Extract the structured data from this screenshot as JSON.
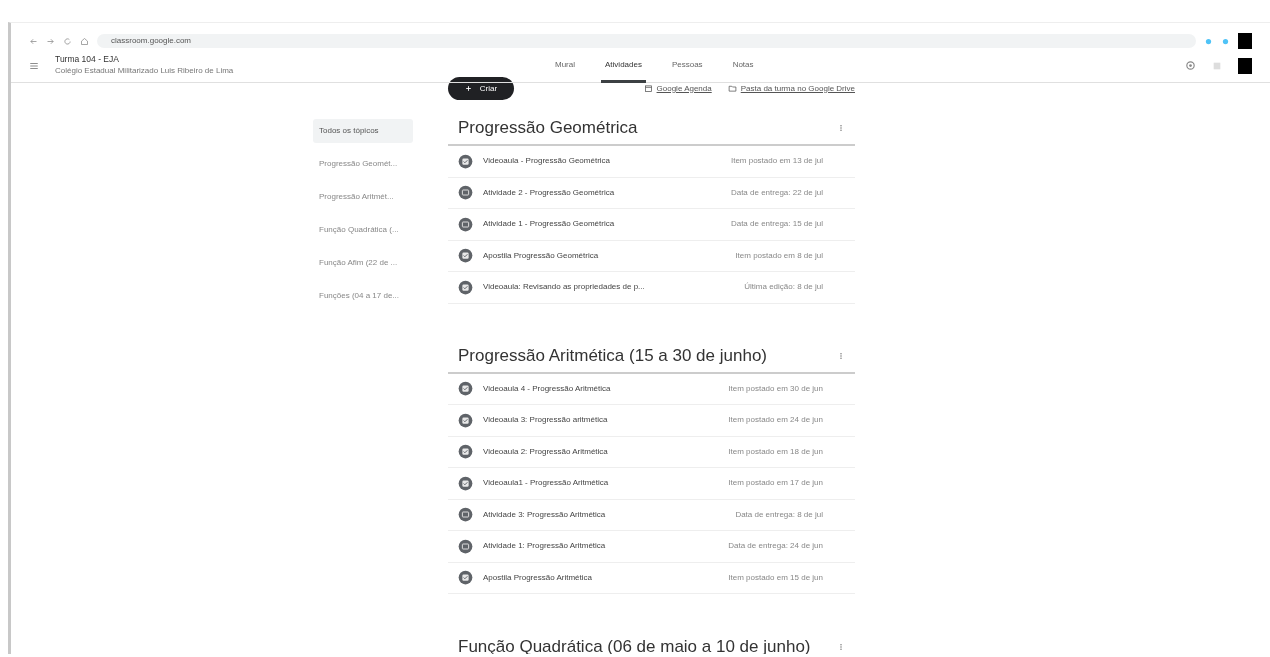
{
  "browser": {
    "url": "classroom.google.com"
  },
  "header": {
    "title": "Turma 104 - EJA",
    "subtitle": "Colégio Estadual Militarizado Luis Ribeiro de Lima"
  },
  "tabs": [
    {
      "label": "Mural",
      "selected": false
    },
    {
      "label": "Atividades",
      "selected": true
    },
    {
      "label": "Pessoas",
      "selected": false
    },
    {
      "label": "Notas",
      "selected": false
    }
  ],
  "create_button": "Criar",
  "links": [
    {
      "label": "Google Agenda",
      "kind": "calendar"
    },
    {
      "label": "Pasta da turma no Google Drive",
      "kind": "folder"
    }
  ],
  "sidebar": {
    "items": [
      {
        "label": "Todos os tópicos",
        "selected": true
      },
      {
        "label": "Progressão Geomét...",
        "selected": false
      },
      {
        "label": "Progressão Aritmét...",
        "selected": false
      },
      {
        "label": "Função Quadrática (...",
        "selected": false
      },
      {
        "label": "Função Afim (22 de ...",
        "selected": false
      },
      {
        "label": "Funções (04 a 17 de...",
        "selected": false
      }
    ]
  },
  "topics": [
    {
      "title": "Progressão Geométrica",
      "items": [
        {
          "kind": "material",
          "title": "Videoaula - Progressão Geométrica",
          "meta": "Item postado em 13 de jul"
        },
        {
          "kind": "assignment",
          "title": "Atividade 2 - Progressão Geométrica",
          "meta": "Data de entrega: 22 de jul"
        },
        {
          "kind": "assignment",
          "title": "Atividade 1 - Progressão Geométrica",
          "meta": "Data de entrega: 15 de jul"
        },
        {
          "kind": "material",
          "title": "Apostila Progressão Geométrica",
          "meta": "Item postado em 8 de jul"
        },
        {
          "kind": "material",
          "title": "Videoaula: Revisando as propriedades de p...",
          "meta": "Última edição: 8 de jul"
        }
      ]
    },
    {
      "title": "Progressão Aritmética (15 a 30 de junho)",
      "items": [
        {
          "kind": "material",
          "title": "Videoaula 4 - Progressão Aritmética",
          "meta": "Item postado em 30 de jun"
        },
        {
          "kind": "material",
          "title": "Videoaula 3: Progressão aritmética",
          "meta": "Item postado em 24 de jun"
        },
        {
          "kind": "material",
          "title": "Videoaula 2: Progressão Aritmética",
          "meta": "Item postado em 18 de jun"
        },
        {
          "kind": "material",
          "title": "Videoaula1 - Progressão Aritmética",
          "meta": "Item postado em 17 de jun"
        },
        {
          "kind": "assignment",
          "title": "Atividade 3: Progressão Aritmética",
          "meta": "Data de entrega: 8 de jul"
        },
        {
          "kind": "assignment",
          "title": "Atividade 1: Progressão Aritmética",
          "meta": "Data de entrega: 24 de jun"
        },
        {
          "kind": "material",
          "title": "Apostila Progressão Aritmética",
          "meta": "Item postado em 15 de jun"
        }
      ]
    },
    {
      "title": "Função Quadrática (06 de maio a 10 de junho)"
    }
  ]
}
